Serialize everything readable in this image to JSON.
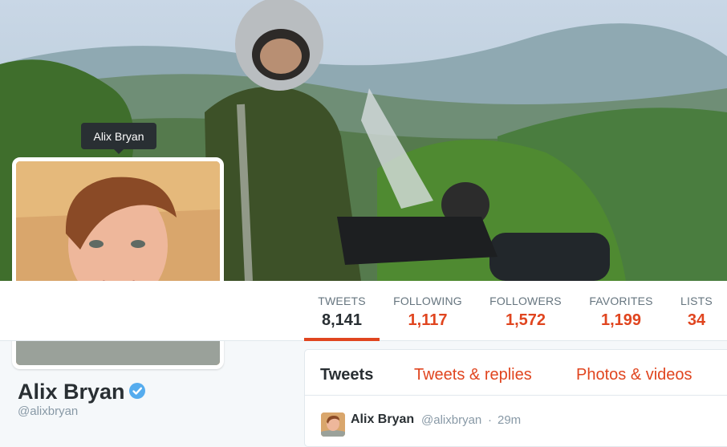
{
  "profile": {
    "name": "Alix Bryan",
    "handle": "@alixbryan",
    "tooltip": "Alix Bryan",
    "verified": true
  },
  "stats": [
    {
      "label": "TWEETS",
      "value": "8,141",
      "active": true
    },
    {
      "label": "FOLLOWING",
      "value": "1,117",
      "active": false
    },
    {
      "label": "FOLLOWERS",
      "value": "1,572",
      "active": false
    },
    {
      "label": "FAVORITES",
      "value": "1,199",
      "active": false
    },
    {
      "label": "LISTS",
      "value": "34",
      "active": false
    }
  ],
  "timeline": {
    "tabs": [
      {
        "label": "Tweets",
        "active": true
      },
      {
        "label": "Tweets & replies",
        "active": false
      },
      {
        "label": "Photos & videos",
        "active": false
      }
    ],
    "tweet": {
      "author": "Alix Bryan",
      "handle": "@alixbryan",
      "separator": "·",
      "time": "29m"
    }
  },
  "colors": {
    "accent": "#e0451f",
    "text": "#292f33",
    "muted": "#8899a6",
    "verified": "#55acee"
  },
  "icons": {
    "verified": "verified-badge-icon"
  }
}
